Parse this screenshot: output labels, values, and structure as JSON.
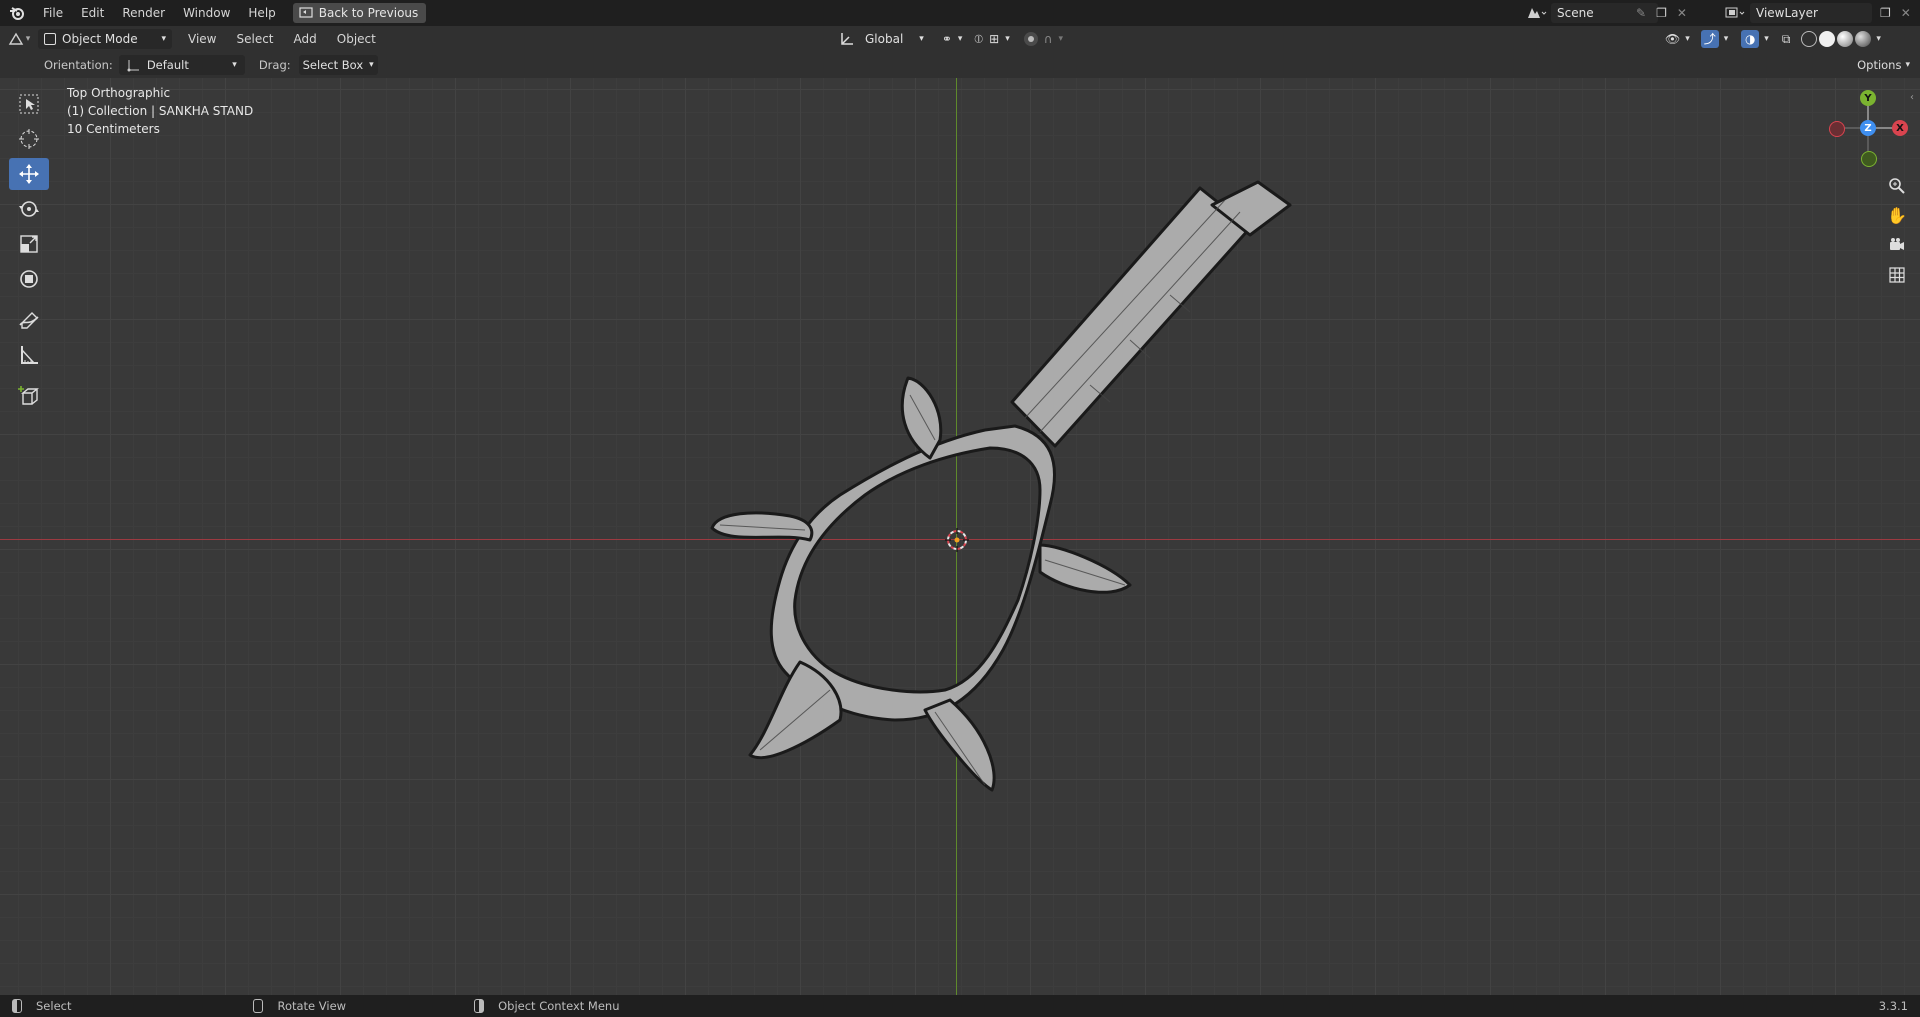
{
  "topbar": {
    "menus": [
      "File",
      "Edit",
      "Render",
      "Window",
      "Help"
    ],
    "back_button": "Back to Previous",
    "scene": "Scene",
    "view_layer": "ViewLayer"
  },
  "header": {
    "mode": "Object Mode",
    "menus": [
      "View",
      "Select",
      "Add",
      "Object"
    ],
    "transform_orientation": "Global",
    "options": "Options"
  },
  "tool_settings": {
    "orientation_label": "Orientation:",
    "orientation_value": "Default",
    "drag_label": "Drag:",
    "drag_value": "Select Box"
  },
  "viewport": {
    "view_name": "Top Orthographic",
    "collection_info": "(1) Collection | SANKHA STAND",
    "grid_scale": "10 Centimeters",
    "gizmo_labels": {
      "y": "Y",
      "z": "Z",
      "x": "X"
    }
  },
  "toolbar": {
    "tools": [
      "select-box",
      "cursor",
      "move",
      "rotate",
      "scale",
      "transform",
      "annotate",
      "measure",
      "add-cube"
    ],
    "active_tool": "move"
  },
  "statusbar": {
    "left_action": "Select",
    "middle_action": "Rotate View",
    "right_action": "Object Context Menu",
    "version": "3.3.1"
  },
  "colors": {
    "accent": "#4772b3",
    "x_axis": "#d9444f",
    "y_axis": "#7bb330",
    "z_axis": "#3f8ff0"
  }
}
